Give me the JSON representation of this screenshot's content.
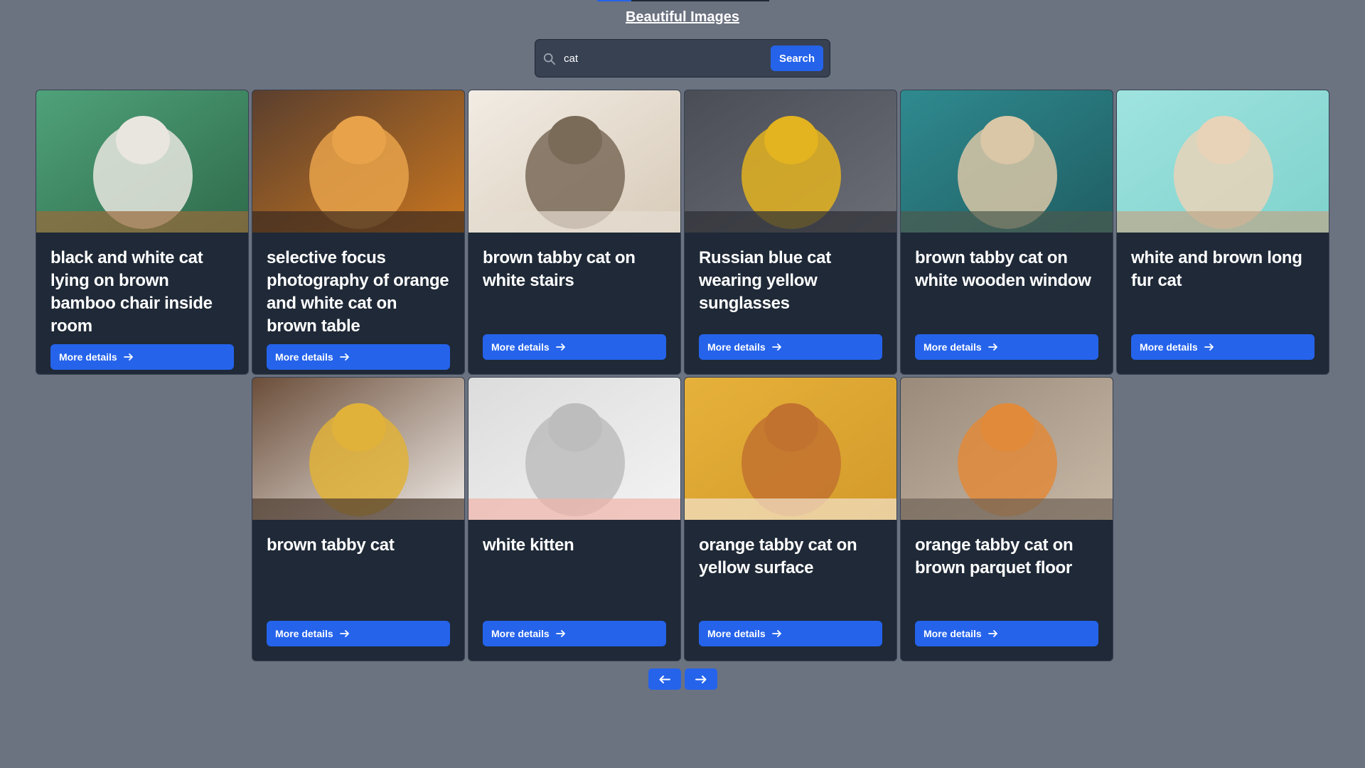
{
  "header": {
    "title": "Beautiful Images"
  },
  "search": {
    "value": "cat",
    "button_label": "Search"
  },
  "cards": [
    {
      "title": "black and white cat lying on brown bamboo chair inside room",
      "button": "More details",
      "colors": [
        "#4fa27a",
        "#2f6b4c",
        "#e9e6df",
        "#9a6a3b"
      ]
    },
    {
      "title": "selective focus photography of orange and white cat on brown table",
      "button": "More details",
      "colors": [
        "#5a3f2e",
        "#c9761f",
        "#e8a24a",
        "#3a2a20"
      ]
    },
    {
      "title": "brown tabby cat on white stairs",
      "button": "More details",
      "colors": [
        "#f2ece4",
        "#d8cbb9",
        "#7a6a58",
        "#e6ddd2"
      ]
    },
    {
      "title": "Russian blue cat wearing yellow sunglasses",
      "button": "More details",
      "colors": [
        "#4a4d55",
        "#6b6e76",
        "#e3b320",
        "#2d2f35"
      ]
    },
    {
      "title": "brown tabby cat on white wooden window",
      "button": "More details",
      "colors": [
        "#2f8a8f",
        "#1f5e63",
        "#d9c7a7",
        "#4c5a4d"
      ]
    },
    {
      "title": "white and brown long fur cat",
      "button": "More details",
      "colors": [
        "#9fe3df",
        "#7fd2cd",
        "#e9d3b8",
        "#bfa789"
      ]
    },
    {
      "title": "brown tabby cat",
      "button": "More details",
      "colors": [
        "#6b4e3a",
        "#efeae6",
        "#e1b23a",
        "#4b3a2f"
      ]
    },
    {
      "title": "white kitten",
      "button": "More details",
      "colors": [
        "#dcdcdc",
        "#f3f3f3",
        "#bdbdbd",
        "#f0b4a8"
      ]
    },
    {
      "title": "orange tabby cat on yellow surface",
      "button": "More details",
      "colors": [
        "#e6b13a",
        "#d39a2a",
        "#c2722f",
        "#f3e6cf"
      ]
    },
    {
      "title": "orange tabby cat on brown parquet floor",
      "button": "More details",
      "colors": [
        "#9a8a7a",
        "#c8b8a6",
        "#e08a3a",
        "#6f6357"
      ]
    }
  ],
  "pagination": {
    "prev_icon": "arrow-left-icon",
    "next_icon": "arrow-right-icon"
  },
  "theme": {
    "accent": "#2563eb",
    "card_bg": "#1f2937",
    "page_bg": "#6b7280"
  }
}
